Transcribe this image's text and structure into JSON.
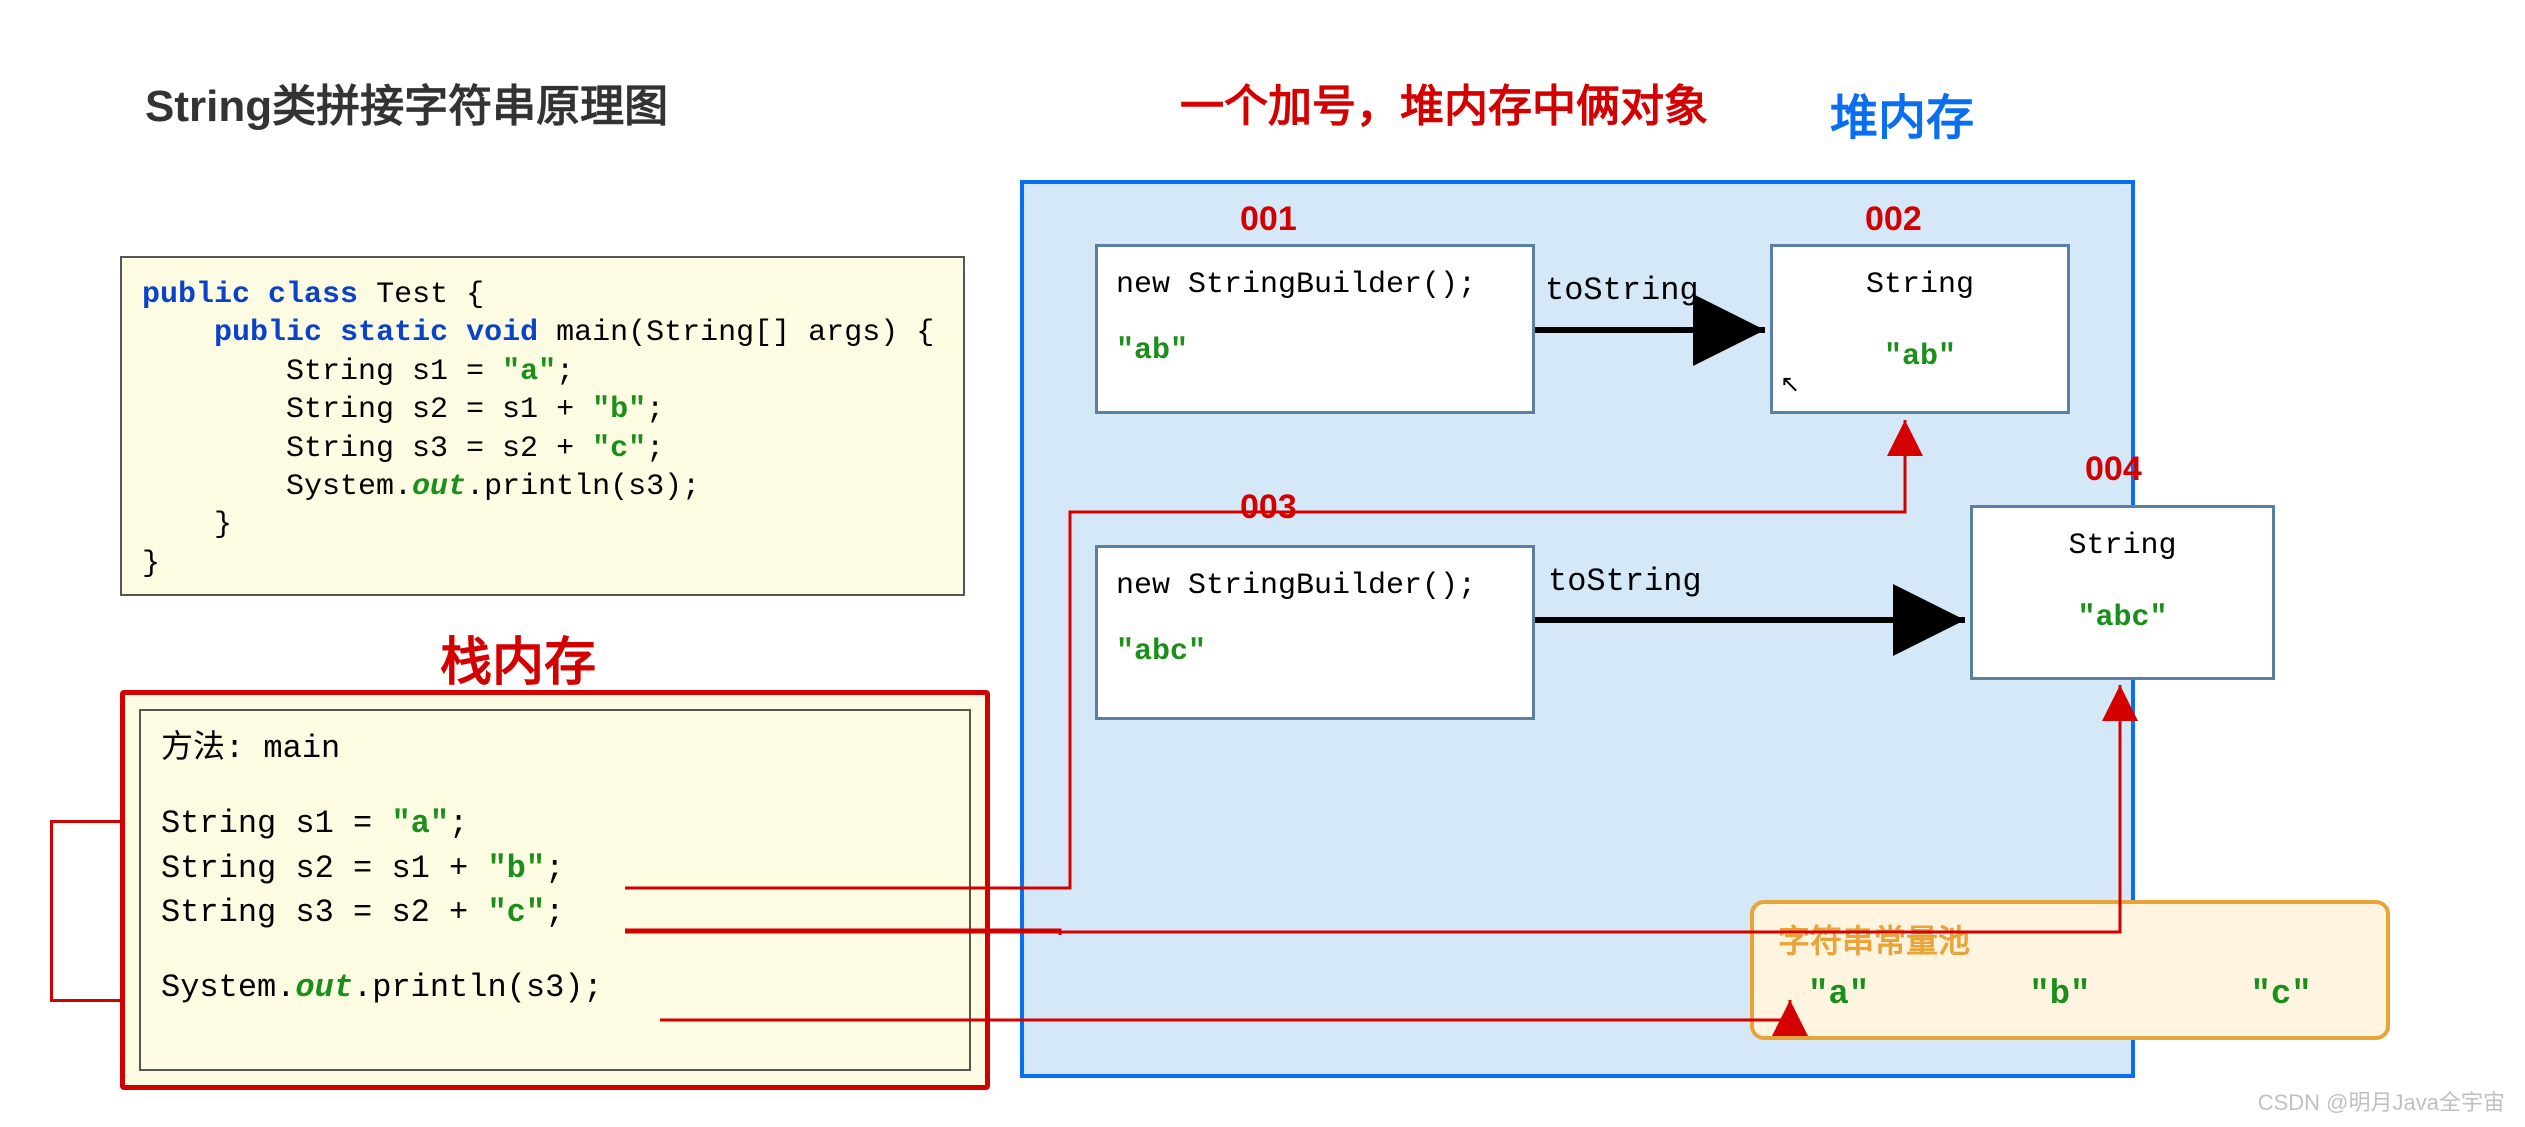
{
  "titles": {
    "main": "String类拼接字符串原理图",
    "redNote": "一个加号，堆内存中俩对象",
    "heap": "堆内存",
    "stack": "栈内存",
    "pool": "字符串常量池"
  },
  "code": {
    "kw_public": "public",
    "kw_class": "class",
    "cls": "Test",
    "kw_static": "static",
    "kw_void": "void",
    "main_sig": "main(String[] args)",
    "line1_a": "        String s1 = ",
    "line1_b": "\"a\"",
    "line1_c": ";",
    "line2_a": "        String s2 = s1 + ",
    "line2_b": "\"b\"",
    "line2_c": ";",
    "line3_a": "        String s3 = s2 + ",
    "line3_b": "\"c\"",
    "line3_c": ";",
    "line4_a": "        System.",
    "line4_b": "out",
    "line4_c": ".println(s3);"
  },
  "stack": {
    "method": "方法: main",
    "s1_a": "String s1 = ",
    "s1_b": "\"a\"",
    "s1_c": ";",
    "s2_a": "String s2 = s1 + ",
    "s2_b": "\"b\"",
    "s2_c": ";",
    "s3_a": "String s3 = s2 + ",
    "s3_b": "\"c\"",
    "s3_c": ";",
    "p_a": "System.",
    "p_b": "out",
    "p_c": ".println(s3);"
  },
  "heap": {
    "addr001": "001",
    "addr002": "002",
    "addr003": "003",
    "addr004": "004",
    "sb_new": "new StringBuilder();",
    "sb1_val": "\"ab\"",
    "str_type": "String",
    "obj002_val": "\"ab\"",
    "sb3_val": "\"abc\"",
    "obj004_val": "\"abc\"",
    "toString": "toString"
  },
  "pool": {
    "a": "\"a\"",
    "b": "\"b\"",
    "c": "\"c\""
  },
  "watermark": "CSDN @明月Java全宇宙"
}
